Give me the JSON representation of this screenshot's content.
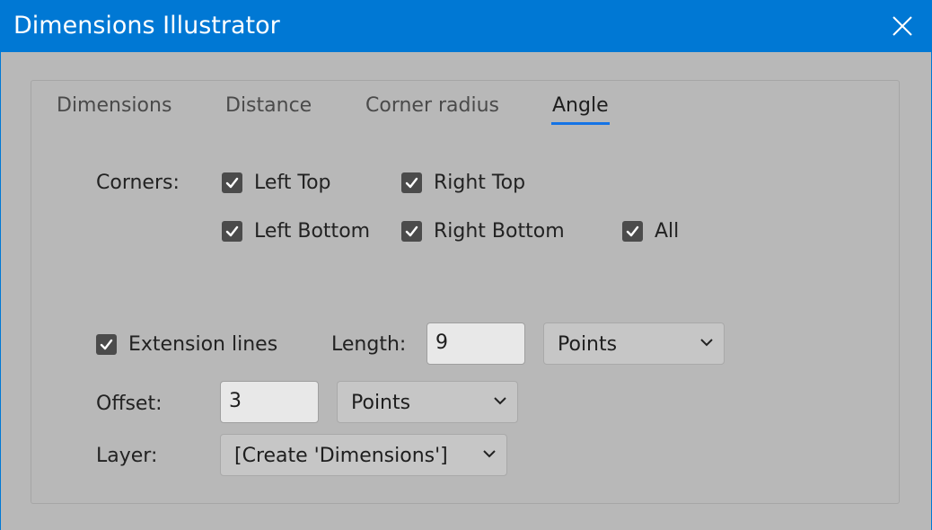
{
  "window": {
    "title": "Dimensions Illustrator",
    "accent_color": "#0078d4",
    "close_icon": "close-icon"
  },
  "tabs": [
    {
      "label": "Dimensions",
      "active": false
    },
    {
      "label": "Distance",
      "active": false
    },
    {
      "label": "Corner radius",
      "active": false
    },
    {
      "label": "Angle",
      "active": true
    }
  ],
  "corners": {
    "label": "Corners:",
    "options": [
      {
        "label": "Left Top",
        "checked": true
      },
      {
        "label": "Right Top",
        "checked": true
      },
      {
        "label": "Left Bottom",
        "checked": true
      },
      {
        "label": "Right Bottom",
        "checked": true
      },
      {
        "label": "All",
        "checked": true
      }
    ]
  },
  "extension_lines": {
    "label": "Extension lines",
    "checked": true,
    "length_label": "Length:",
    "length_value": "9",
    "length_unit": "Points"
  },
  "offset": {
    "label": "Offset:",
    "value": "3",
    "unit": "Points"
  },
  "layer": {
    "label": "Layer:",
    "value": "[Create 'Dimensions']"
  }
}
